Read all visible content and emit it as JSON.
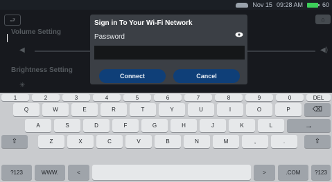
{
  "status_bar": {
    "date": "Nov 15",
    "time": "09:28 AM",
    "battery_partial": "60"
  },
  "background": {
    "back_label": "⮐",
    "home_label": "⌂",
    "volume_label": "Volume Setting",
    "brightness_label": "Brightness Setting"
  },
  "dialog": {
    "title": "Sign in To Your Wi-Fi Network",
    "password_label": "Password",
    "password_value": "",
    "connect_label": "Connect",
    "cancel_label": "Cancel"
  },
  "keyboard": {
    "number_row": [
      "1",
      "2",
      "3",
      "4",
      "5",
      "6",
      "7",
      "8",
      "9",
      "0",
      "DEL"
    ],
    "row1": [
      "Q",
      "W",
      "E",
      "R",
      "T",
      "Y",
      "U",
      "I",
      "O",
      "P",
      "⌫"
    ],
    "row2": [
      "A",
      "S",
      "D",
      "F",
      "G",
      "H",
      "J",
      "K",
      "L",
      "→"
    ],
    "row3": [
      "⇧",
      "Z",
      "X",
      "C",
      "V",
      "B",
      "N",
      "M",
      ",",
      ".",
      "⇧"
    ],
    "row4": [
      "?123",
      "WWW.",
      "<",
      "",
      ">",
      ".COM",
      "?123"
    ]
  },
  "icons": {
    "status_car": "car-icon",
    "status_battery": "battery-icon",
    "eye": "eye-icon",
    "accent_button": "#0f3f78"
  }
}
